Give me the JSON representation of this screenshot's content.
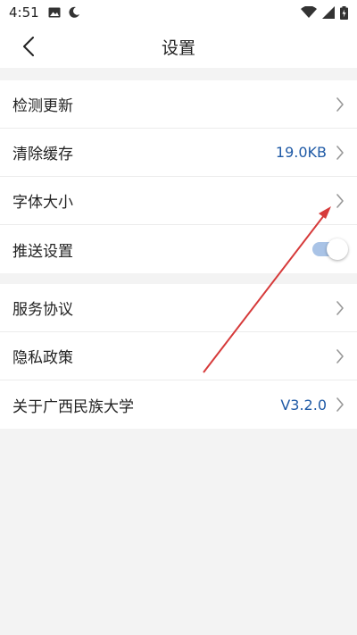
{
  "status_bar": {
    "time": "4:51",
    "icons": [
      "image-icon",
      "moon-icon",
      "wifi-icon",
      "signal-icon",
      "battery-icon"
    ]
  },
  "header": {
    "title": "设置",
    "back_icon": "chevron-left-icon"
  },
  "settings_group_1": [
    {
      "label": "检测更新",
      "value": ""
    },
    {
      "label": "清除缓存",
      "value": "19.0KB"
    },
    {
      "label": "字体大小",
      "value": ""
    },
    {
      "label": "推送设置",
      "toggle": true
    }
  ],
  "settings_group_2": [
    {
      "label": "服务协议",
      "value": ""
    },
    {
      "label": "隐私政策",
      "value": ""
    },
    {
      "label": "关于广西民族大学",
      "value": "V3.2.0"
    }
  ],
  "colors": {
    "accent": "#1f5aa6",
    "toggle_track": "#a9c3e6",
    "annotation": "#d63a3a",
    "background": "#f3f3f3"
  }
}
